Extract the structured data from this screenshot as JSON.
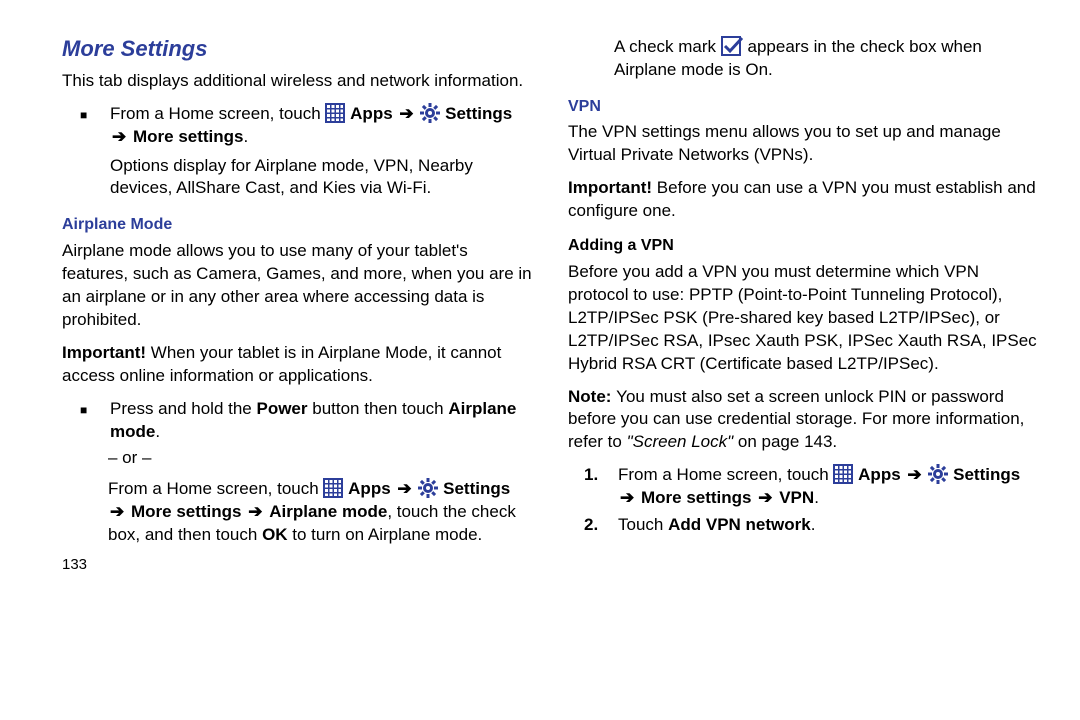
{
  "headings": {
    "more_settings": "More Settings",
    "airplane_mode": "Airplane Mode",
    "vpn": "VPN",
    "adding_vpn": "Adding a VPN"
  },
  "text": {
    "intro": "This tab displays additional wireless and network information.",
    "from_home_a": "From a Home screen, touch ",
    "apps": " Apps ",
    "settings": " Settings ",
    "more_settings_path": " More settings",
    "options_display": "Options display for Airplane mode, VPN, Nearby devices, AllShare Cast, and Kies via Wi-Fi.",
    "airplane_desc": "Airplane mode allows you to use many of your tablet's features, such as Camera, Games, and more, when you are in an airplane or in any other area where accessing data is prohibited.",
    "important_label": "Important! ",
    "airplane_important": "When your tablet is in Airplane Mode, it cannot access online information or applications.",
    "press_hold_a": "Press and hold the ",
    "power": "Power",
    "press_hold_b": " button then touch ",
    "airplane_mode_label": "Airplane mode",
    "or": "– or –",
    "more_settings_arrow": " More settings ",
    "airplane_mode_arrow": " Airplane mode",
    "touch_checkbox": ", touch the check box, and then touch ",
    "ok": "OK",
    "turn_on_airplane": " to turn on Airplane mode.",
    "checkmark_a": "A check mark ",
    "checkmark_b": " appears in the check box when Airplane mode is On.",
    "vpn_desc": "The VPN settings menu allows you to set up and manage Virtual Private Networks (VPNs).",
    "vpn_important": "Before you can use a VPN you must establish and configure one.",
    "adding_desc": "Before you add a VPN you must determine which VPN protocol to use: PPTP (Point-to-Point Tunneling Protocol), L2TP/IPSec PSK (Pre-shared key based L2TP/IPSec), or L2TP/IPSec RSA, IPsec Xauth PSK, IPSec Xauth RSA, IPSec Hybrid RSA CRT (Certificate based L2TP/IPSec).",
    "note_label": "Note: ",
    "note_a": "You must also set a screen unlock PIN or password before you can use credential storage. For more information, refer to ",
    "screen_lock_ref": "\"Screen Lock\"",
    "on_page": " on page 143.",
    "more_settings_vpn": " More settings ",
    "vpn_path": " VPN",
    "step2_a": "Touch ",
    "add_vpn_network": "Add VPN network",
    "arrow": "➔",
    "period": "."
  },
  "numbers": {
    "step1": "1.",
    "step2": "2.",
    "page": "133"
  }
}
